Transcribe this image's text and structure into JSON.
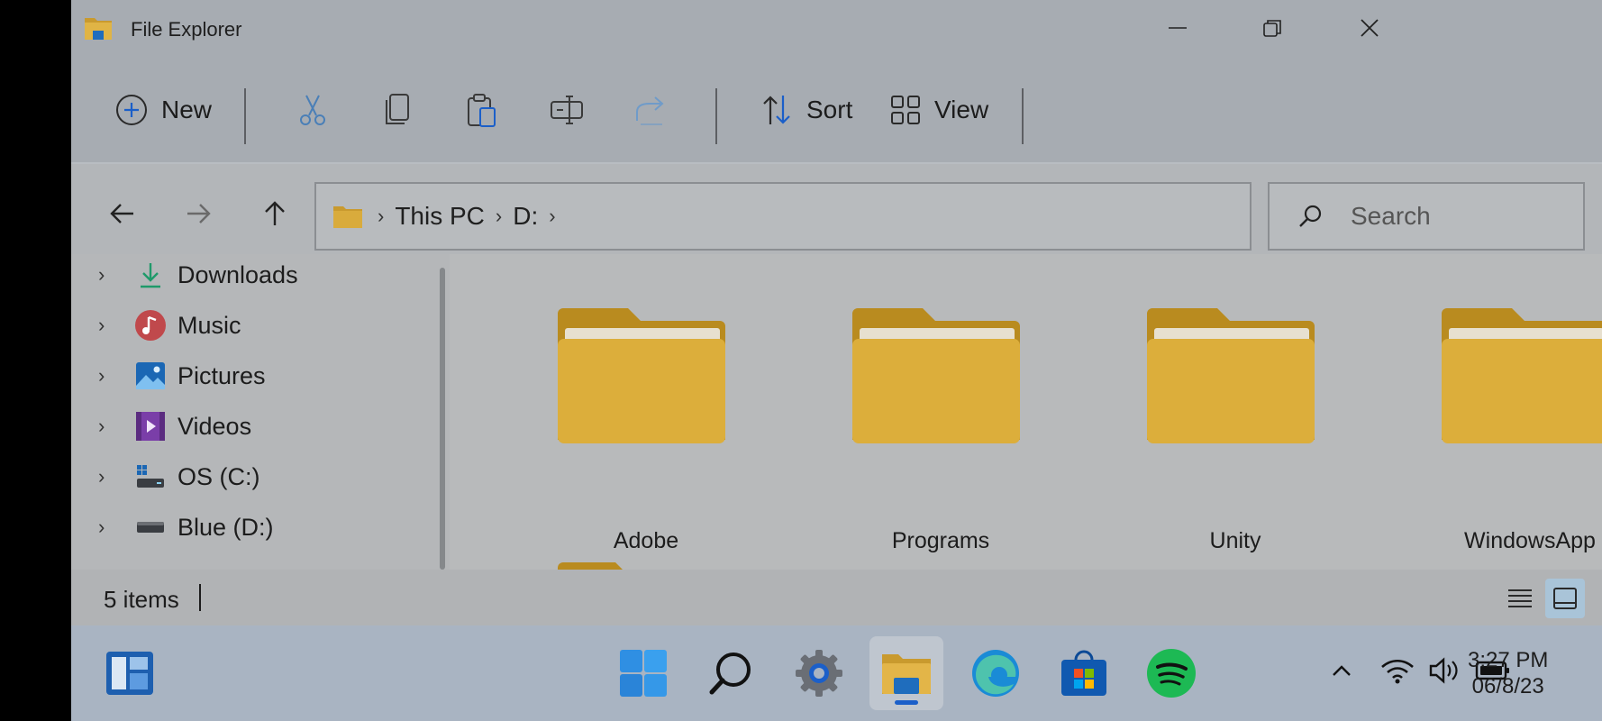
{
  "window": {
    "title": "File Explorer"
  },
  "toolbar": {
    "new_label": "New",
    "sort_label": "Sort",
    "view_label": "View"
  },
  "address": {
    "crumbs": [
      "This PC",
      "D:"
    ]
  },
  "search": {
    "placeholder": "Search"
  },
  "sidebar": {
    "items": [
      {
        "label": "Downloads",
        "icon": "download-icon"
      },
      {
        "label": "Music",
        "icon": "music-icon"
      },
      {
        "label": "Pictures",
        "icon": "pictures-icon"
      },
      {
        "label": "Videos",
        "icon": "videos-icon"
      },
      {
        "label": "OS (C:)",
        "icon": "os-drive-icon"
      },
      {
        "label": "Blue (D:)",
        "icon": "drive-icon"
      }
    ]
  },
  "folders": [
    {
      "name": "Adobe"
    },
    {
      "name": "Programs"
    },
    {
      "name": "Unity"
    },
    {
      "name": "WindowsApp"
    }
  ],
  "status": {
    "item_count": "5 items"
  },
  "clock": {
    "time": "3:27 PM",
    "date": "06/8/23"
  },
  "colors": {
    "folder": "#d9aa34",
    "accent": "#1b5fc9"
  }
}
